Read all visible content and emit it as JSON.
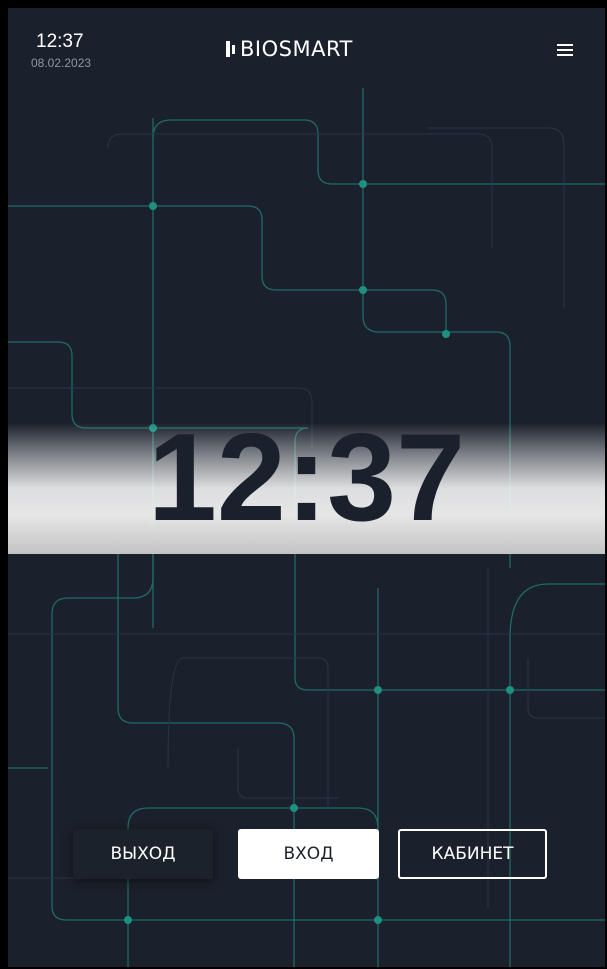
{
  "status_bar": {
    "time": "12:37",
    "date": "08.02.2023"
  },
  "header": {
    "logo_text": "BIOSMART",
    "menu_icon": "hamburger-menu-icon"
  },
  "clock": {
    "time": "12:37"
  },
  "actions": {
    "exit_label": "ВЫХОД",
    "enter_label": "ВХОД",
    "cabinet_label": "КАБИНЕТ"
  },
  "colors": {
    "background": "#1b212c",
    "circuit_line": "#1f6f68",
    "circuit_node": "#1f8f82",
    "text": "#ffffff"
  }
}
